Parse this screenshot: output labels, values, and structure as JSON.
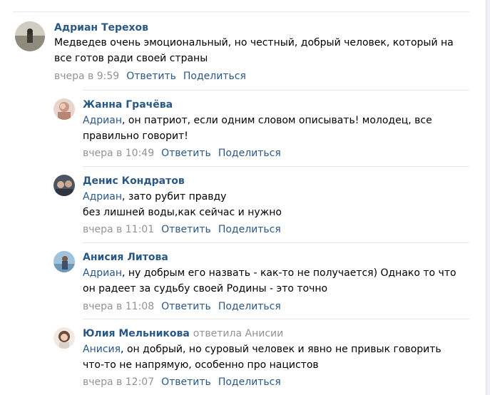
{
  "colors": {
    "link": "#2a5885",
    "muted": "#939393",
    "divider": "#e7e8ec"
  },
  "comments": [
    {
      "author": "Адриан Терехов",
      "avatar_icon": "user-photo-avatar",
      "lines": [
        "Медведев очень эмоциональный, но честный, добрый человек, который на",
        "все готов ради своей страны"
      ],
      "time": "вчера в 9:59",
      "reply_label": "Ответить",
      "share_label": "Поделиться"
    },
    {
      "author": "Жанна Грачёва",
      "avatar_icon": "user-photo-avatar",
      "mention": "Адриан",
      "lines": [
        ", он патриот, если одним словом описывать! молодец, все",
        "правильно говорит!"
      ],
      "time": "вчера в 10:49",
      "reply_label": "Ответить",
      "share_label": "Поделиться"
    },
    {
      "author": "Денис Кондратов",
      "avatar_icon": "user-photo-avatar",
      "mention": "Адриан",
      "lines": [
        ", зато рубит правду",
        "без лишней воды,как сейчас и нужно"
      ],
      "time": "вчера в 11:01",
      "reply_label": "Ответить",
      "share_label": "Поделиться"
    },
    {
      "author": "Анисия Литова",
      "avatar_icon": "user-photo-avatar",
      "mention": "Адриан",
      "lines": [
        ", ну добрым его назвать - как-то не получается) Однако то что",
        "он радеет за судьбу своей Родины - это точно"
      ],
      "time": "вчера в 11:08",
      "reply_label": "Ответить",
      "share_label": "Поделиться"
    },
    {
      "author": "Юлия Мельникова",
      "reply_note": "ответила Анисии",
      "avatar_icon": "user-photo-avatar",
      "mention": "Анисия",
      "lines": [
        ", он добрый, но суровый человек и явно не привык говорить",
        "что-то не напрямую, особенно про нацистов"
      ],
      "time": "вчера в 12:07",
      "reply_label": "Ответить",
      "share_label": "Поделиться"
    }
  ]
}
